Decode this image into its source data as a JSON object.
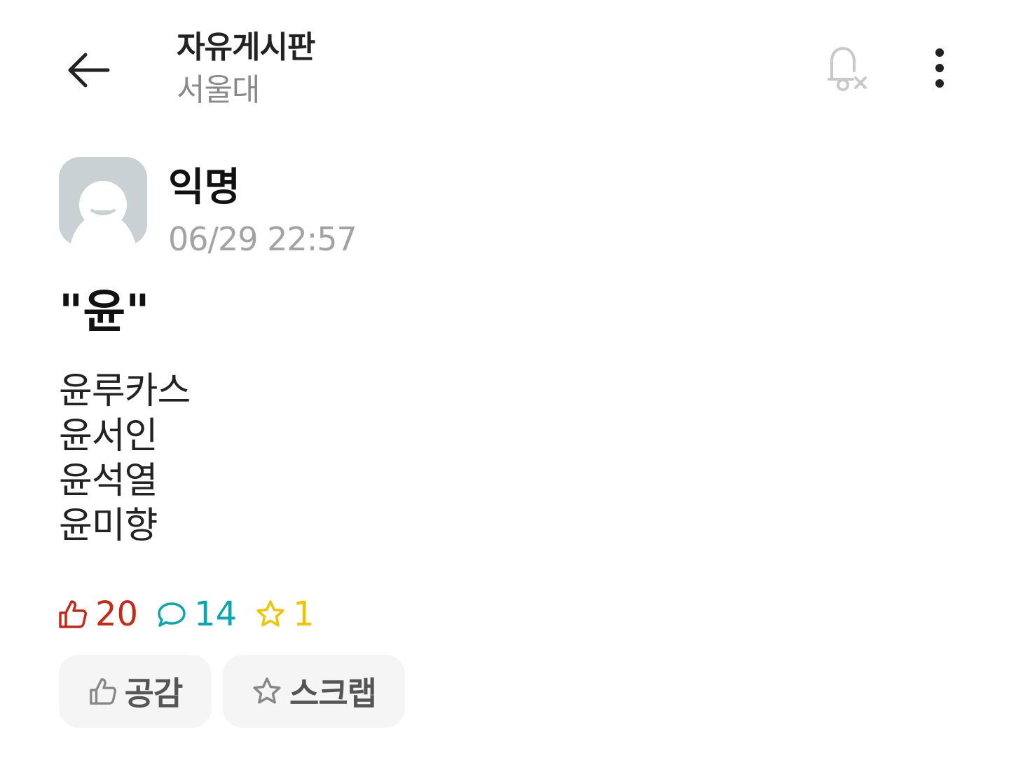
{
  "header": {
    "board_title": "자유게시판",
    "board_subtitle": "서울대",
    "back_icon": "arrow-left-icon",
    "notification_icon": "bell-off-icon",
    "more_icon": "more-vertical-icon"
  },
  "post": {
    "author_name": "익명",
    "timestamp": "06/29 22:57",
    "title": "\"윤\"",
    "body_lines": [
      "윤루카스",
      "윤서인",
      "윤석열",
      "윤미향"
    ]
  },
  "stats": {
    "likes": "20",
    "comments": "14",
    "scraps": "1"
  },
  "actions": {
    "like_label": "공감",
    "scrap_label": "스크랩"
  },
  "colors": {
    "like": "#c62917",
    "comment": "#0ca5b0",
    "scrap": "#f0c400",
    "avatar_bg": "#c9d1d5",
    "button_bg": "#f5f5f5"
  }
}
